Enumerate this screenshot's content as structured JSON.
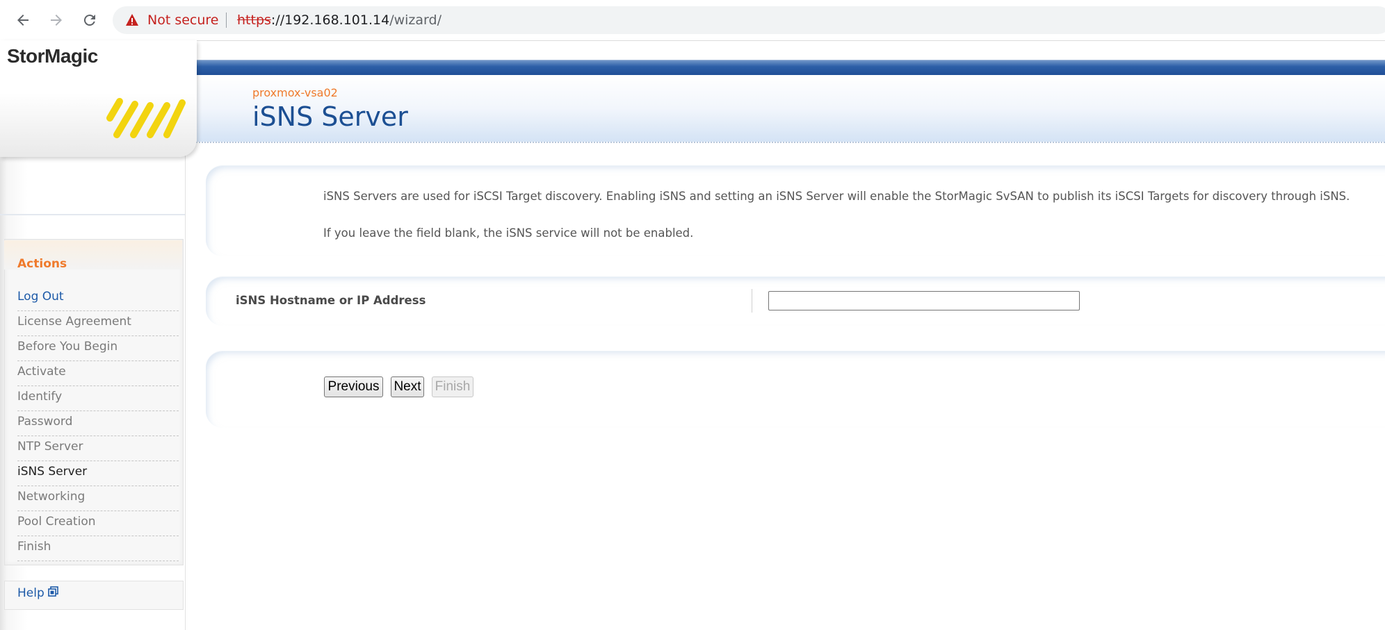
{
  "browser": {
    "security_label": "Not secure",
    "url_scheme": "https",
    "url_host": "://192.168.101.14",
    "url_path": "/wizard/"
  },
  "header": {
    "logo": "StorMagic",
    "hostname": "proxmox-vsa02",
    "title": "iSNS Server"
  },
  "sidebar": {
    "actions_title": "Actions",
    "items": [
      {
        "label": "Log Out"
      },
      {
        "label": "License Agreement"
      },
      {
        "label": "Before You Begin"
      },
      {
        "label": "Activate"
      },
      {
        "label": "Identify"
      },
      {
        "label": "Password"
      },
      {
        "label": "NTP Server"
      },
      {
        "label": "iSNS Server"
      },
      {
        "label": "Networking"
      },
      {
        "label": "Pool Creation"
      },
      {
        "label": "Finish"
      }
    ],
    "help": "Help"
  },
  "content": {
    "description_1": "iSNS Servers are used for iSCSI Target discovery. Enabling iSNS and setting an iSNS Server will enable the StorMagic SvSAN to publish its iSCSI Targets for discovery through iSNS.",
    "description_2": "If you leave the field blank, the iSNS service will not be enabled.",
    "field_label": "iSNS Hostname or IP Address",
    "field_value": ""
  },
  "buttons": {
    "previous": "Previous",
    "next": "Next",
    "finish": "Finish"
  },
  "colors": {
    "accent_orange": "#ef7a2b",
    "title_blue": "#1c4f93",
    "link_blue": "#1d5aa8",
    "logo_yellow": "#f2d40f"
  }
}
